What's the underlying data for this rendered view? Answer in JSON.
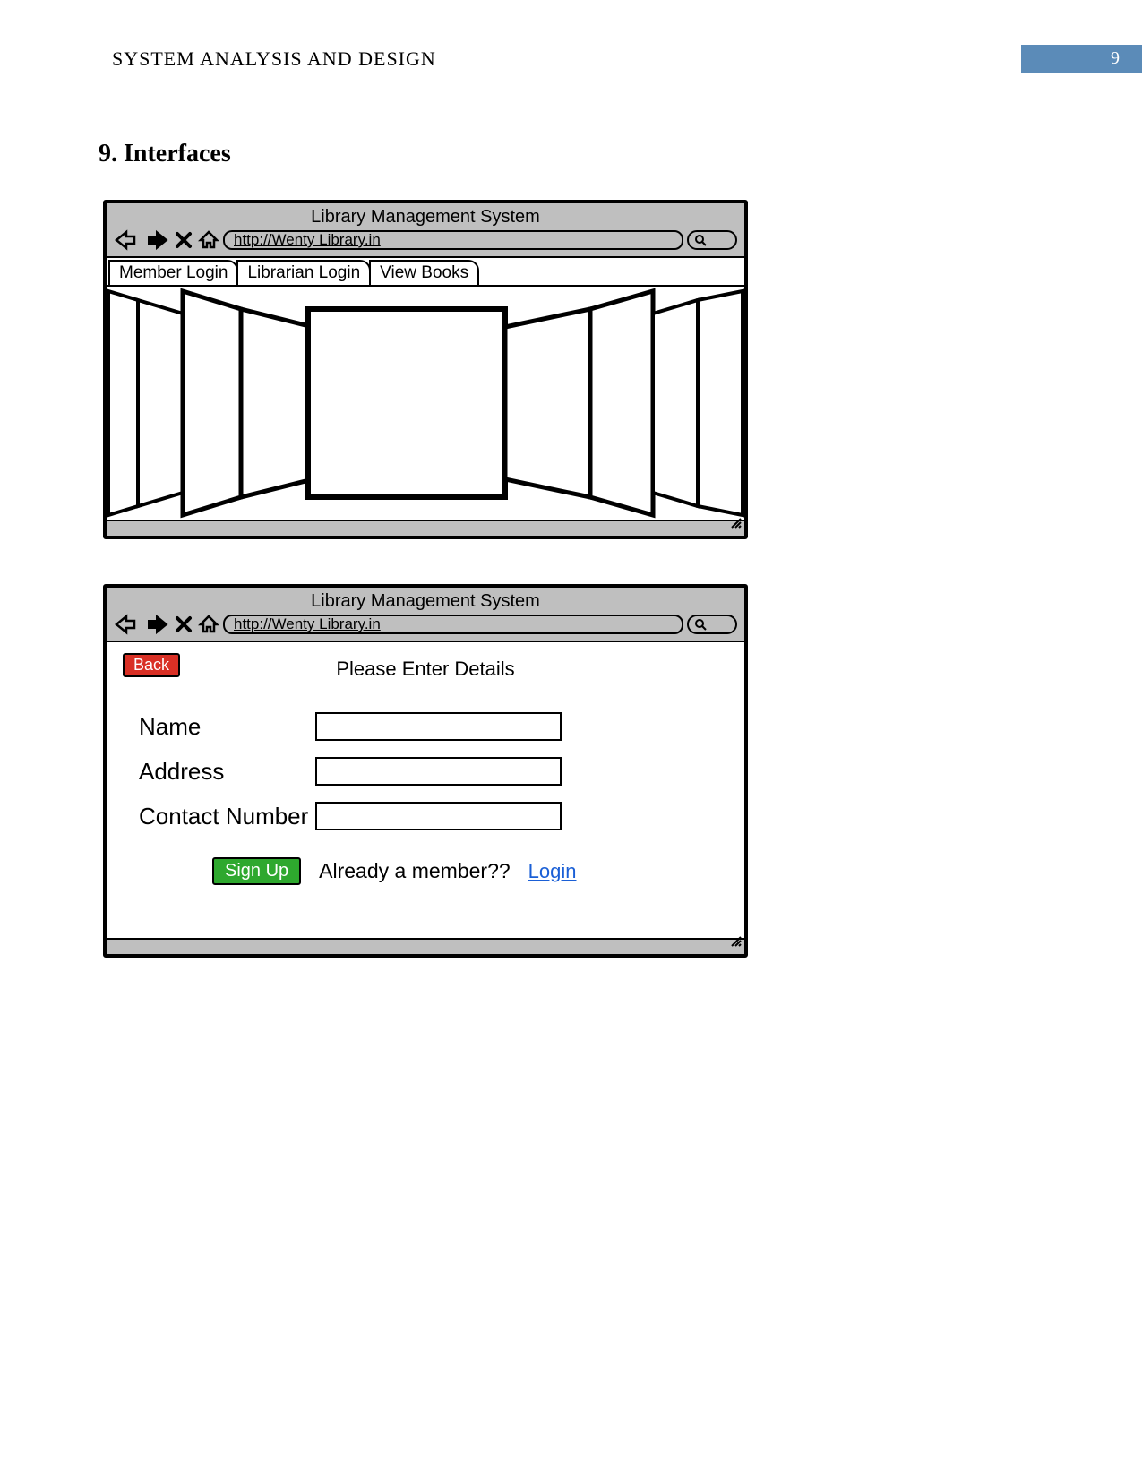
{
  "header": {
    "title": "SYSTEM ANALYSIS AND DESIGN",
    "page_number": "9"
  },
  "section": {
    "heading": "9. Interfaces"
  },
  "mockup1": {
    "window_title": "Library Management System",
    "url": "http://Wenty Library.in",
    "tabs": [
      "Member Login",
      "Librarian Login",
      "View Books"
    ]
  },
  "mockup2": {
    "window_title": "Library Management System",
    "url": "http://Wenty Library.in",
    "back_label": "Back",
    "form_title": "Please Enter Details",
    "fields": [
      {
        "label": "Name"
      },
      {
        "label": "Address"
      },
      {
        "label": "Contact Number"
      }
    ],
    "signup_label": "Sign Up",
    "member_prompt": "Already a member??",
    "login_link": "Login"
  }
}
